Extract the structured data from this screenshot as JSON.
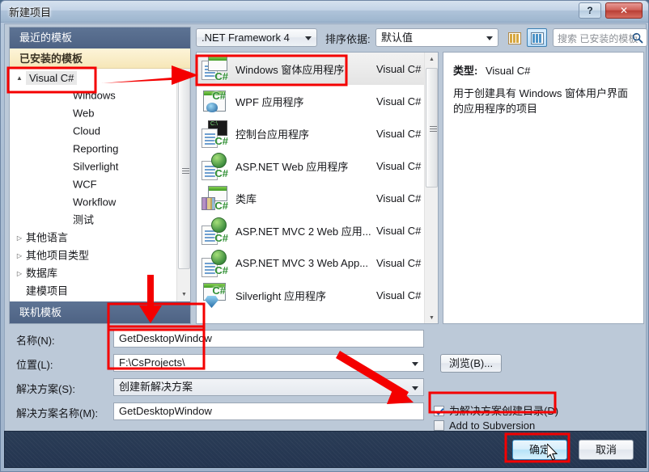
{
  "window": {
    "title": "新建项目",
    "help_button": "?",
    "close_button": "✕"
  },
  "left_panel": {
    "recent_header": "最近的模板",
    "installed_header": "已安装的模板",
    "online_header": "联机模板",
    "tree": [
      {
        "label": "Visual C#",
        "level": 0,
        "expander": "▲",
        "selected": true
      },
      {
        "label": "Windows",
        "level": 1,
        "expander": "",
        "selected": false
      },
      {
        "label": "Web",
        "level": 1,
        "expander": "",
        "selected": false
      },
      {
        "label": "Cloud",
        "level": 1,
        "expander": "",
        "selected": false
      },
      {
        "label": "Reporting",
        "level": 1,
        "expander": "",
        "selected": false
      },
      {
        "label": "Silverlight",
        "level": 1,
        "expander": "",
        "selected": false
      },
      {
        "label": "WCF",
        "level": 1,
        "expander": "",
        "selected": false
      },
      {
        "label": "Workflow",
        "level": 1,
        "expander": "",
        "selected": false
      },
      {
        "label": "测试",
        "level": 1,
        "expander": "",
        "selected": false
      },
      {
        "label": "其他语言",
        "level": 0,
        "expander": "▷",
        "selected": false
      },
      {
        "label": "其他项目类型",
        "level": 0,
        "expander": "▷",
        "selected": false
      },
      {
        "label": "数据库",
        "level": 0,
        "expander": "▷",
        "selected": false
      },
      {
        "label": "建模项目",
        "level": 0,
        "expander": "",
        "selected": false
      }
    ]
  },
  "toolbar": {
    "framework": ".NET Framework 4",
    "sort_label": "排序依据:",
    "sort_value": "默认值",
    "view_tiles_name": "medium-icons-view",
    "view_list_name": "large-icons-view",
    "search_placeholder": "搜索 已安装的模板",
    "search_value": ""
  },
  "templates": [
    {
      "name": "Windows 窗体应用程序",
      "lang": "Visual C#",
      "icon": "winforms-icon",
      "selected": true
    },
    {
      "name": "WPF 应用程序",
      "lang": "Visual C#",
      "icon": "wpf-icon",
      "selected": false
    },
    {
      "name": "控制台应用程序",
      "lang": "Visual C#",
      "icon": "console-icon",
      "selected": false
    },
    {
      "name": "ASP.NET Web 应用程序",
      "lang": "Visual C#",
      "icon": "aspnet-icon",
      "selected": false
    },
    {
      "name": "类库",
      "lang": "Visual C#",
      "icon": "classlib-icon",
      "selected": false
    },
    {
      "name": "ASP.NET MVC 2 Web 应用...",
      "lang": "Visual C#",
      "icon": "aspnet-icon",
      "selected": false
    },
    {
      "name": "ASP.NET MVC 3 Web App...",
      "lang": "Visual C#",
      "icon": "aspnet-icon",
      "selected": false
    },
    {
      "name": "Silverlight 应用程序",
      "lang": "Visual C#",
      "icon": "silverlight-icon",
      "selected": false
    }
  ],
  "description": {
    "type_label": "类型:",
    "type_value": "Visual C#",
    "text": "用于创建具有 Windows 窗体用户界面的应用程序的项目"
  },
  "form": {
    "name_label": "名称(N):",
    "name_value": "GetDesktopWindow",
    "location_label": "位置(L):",
    "location_value": "F:\\CsProjects\\",
    "solution_label": "解决方案(S):",
    "solution_value": "创建新解决方案",
    "solution_name_label": "解决方案名称(M):",
    "solution_name_value": "GetDesktopWindow",
    "browse_button": "浏览(B)...",
    "create_dir_checkbox": "为解决方案创建目录(D)",
    "create_dir_checked": true,
    "subversion_checkbox": "Add to Subversion",
    "subversion_checked": false
  },
  "footer": {
    "ok_button": "确定",
    "cancel_button": "取消"
  }
}
